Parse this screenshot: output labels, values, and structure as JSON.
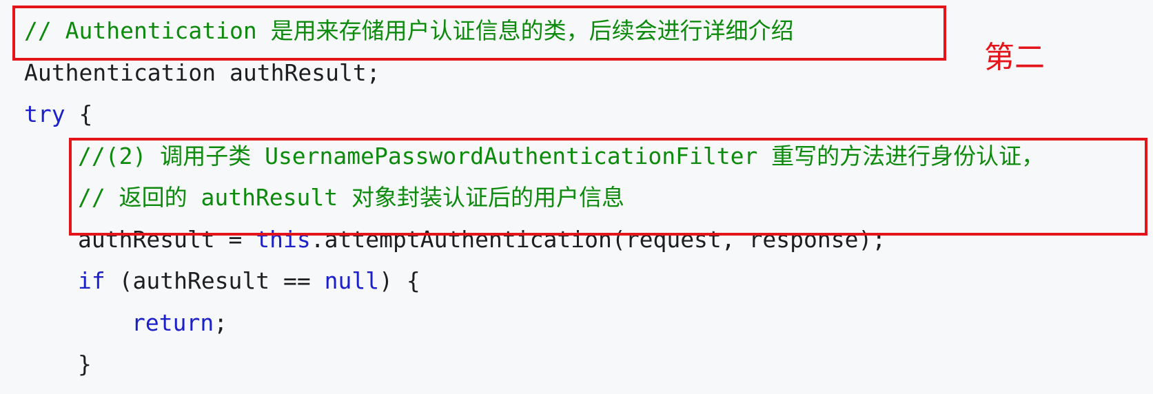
{
  "code": {
    "lines": [
      {
        "tokens": [
          {
            "type": "comment",
            "text": "// Authentication 是用来存储用户认证信息的类，后续会进行详细介绍"
          }
        ]
      },
      {
        "tokens": [
          {
            "type": "plain",
            "text": "Authentication authResult;"
          }
        ]
      },
      {
        "tokens": [
          {
            "type": "keyword",
            "text": "try"
          },
          {
            "type": "plain",
            "text": " {"
          }
        ]
      },
      {
        "tokens": [
          {
            "type": "comment",
            "text": "//(2) 调用子类 UsernamePasswordAuthenticationFilter 重写的方法进行身份认证，"
          }
        ]
      },
      {
        "tokens": [
          {
            "type": "comment",
            "text": "// 返回的 authResult 对象封装认证后的用户信息"
          }
        ]
      },
      {
        "tokens": [
          {
            "type": "plain",
            "text": "authResult = "
          },
          {
            "type": "keyword",
            "text": "this"
          },
          {
            "type": "plain",
            "text": ".attemptAuthentication(request, response);"
          }
        ]
      },
      {
        "tokens": [
          {
            "type": "keyword",
            "text": "if"
          },
          {
            "type": "plain",
            "text": " (authResult == "
          },
          {
            "type": "keyword",
            "text": "null"
          },
          {
            "type": "plain",
            "text": ") {"
          }
        ]
      },
      {
        "tokens": [
          {
            "type": "keyword",
            "text": "return"
          },
          {
            "type": "plain",
            "text": ";"
          }
        ]
      },
      {
        "tokens": [
          {
            "type": "plain",
            "text": "}"
          }
        ]
      }
    ]
  },
  "annotation": {
    "label": "第二"
  },
  "colors": {
    "background": "#f7f8fa",
    "plain": "#1e1e1e",
    "comment": "#0b8a0b",
    "keyword": "#1c20c8",
    "annotation": "#e4141b"
  }
}
